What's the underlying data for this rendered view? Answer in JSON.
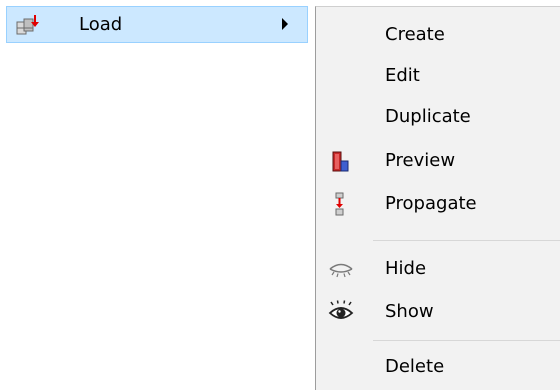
{
  "parent_menu": {
    "item_label": "Load",
    "item_icon": "load-icon",
    "submenu_arrow_icon": "chevron-right-icon",
    "highlight_color": "#cce8ff"
  },
  "submenu": {
    "items": [
      {
        "label": "Create",
        "icon": null
      },
      {
        "label": "Edit",
        "icon": null
      },
      {
        "label": "Duplicate",
        "icon": null
      },
      {
        "label": "Preview",
        "icon": "preview-icon"
      },
      {
        "label": "Propagate",
        "icon": "propagate-icon"
      },
      {
        "label": "Hide",
        "icon": "eye-closed-icon"
      },
      {
        "label": "Show",
        "icon": "eye-open-icon"
      },
      {
        "label": "Delete",
        "icon": null
      }
    ],
    "background": "#f2f2f2"
  }
}
